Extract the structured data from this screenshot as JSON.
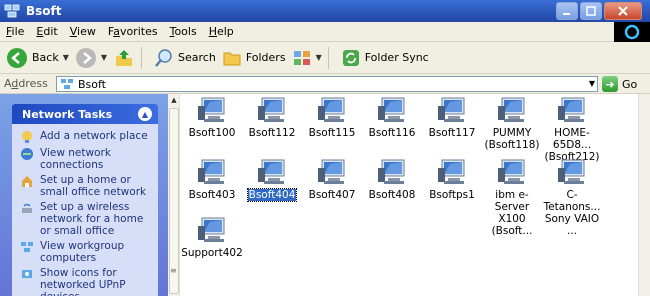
{
  "window": {
    "title": "Bsoft"
  },
  "menu": [
    {
      "underline": "F",
      "rest": "ile"
    },
    {
      "underline": "E",
      "rest": "dit"
    },
    {
      "underline": "V",
      "rest": "iew"
    },
    {
      "pre": "F",
      "underline": "a",
      "rest": "vorites"
    },
    {
      "underline": "T",
      "rest": "ools"
    },
    {
      "underline": "H",
      "rest": "elp"
    }
  ],
  "toolbar": {
    "back_label": "Back",
    "search_label": "Search",
    "folders_label": "Folders",
    "folder_sync_label": "Folder Sync"
  },
  "address": {
    "label_underline": "d",
    "label_pre": "A",
    "label_rest": "dress",
    "value": "Bsoft",
    "go_label": "Go"
  },
  "tasks": {
    "header": "Network Tasks",
    "items": [
      "Add a network place",
      "View network connections",
      "Set up a home or small office network",
      "Set up a wireless network for a home or small office",
      "View workgroup computers",
      "Show icons for networked UPnP devices"
    ]
  },
  "computers": [
    {
      "name": "Bsoft100",
      "selected": false
    },
    {
      "name": "Bsoft112",
      "selected": false
    },
    {
      "name": "Bsoft115",
      "selected": false
    },
    {
      "name": "Bsoft116",
      "selected": false
    },
    {
      "name": "Bsoft117",
      "selected": false
    },
    {
      "name": "PUMMY (Bsoft118)",
      "selected": false
    },
    {
      "name": "HOME-65D8... (Bsoft212)",
      "selected": false
    },
    {
      "name": "Bsoft403",
      "selected": false
    },
    {
      "name": "Bsoft404",
      "selected": true
    },
    {
      "name": "Bsoft407",
      "selected": false
    },
    {
      "name": "Bsoft408",
      "selected": false
    },
    {
      "name": "Bsoftps1",
      "selected": false
    },
    {
      "name": "ibm e-Server X100 (Bsoft...",
      "selected": false
    },
    {
      "name": "C-Tetanons... Sony VAIO ...",
      "selected": false
    },
    {
      "name": "Support402",
      "selected": false
    }
  ],
  "colors": {
    "titlebar": "#2a55b8",
    "selection": "#316ac5",
    "task_link": "#21347d",
    "taskpane_bg": "#6f8fdd"
  }
}
